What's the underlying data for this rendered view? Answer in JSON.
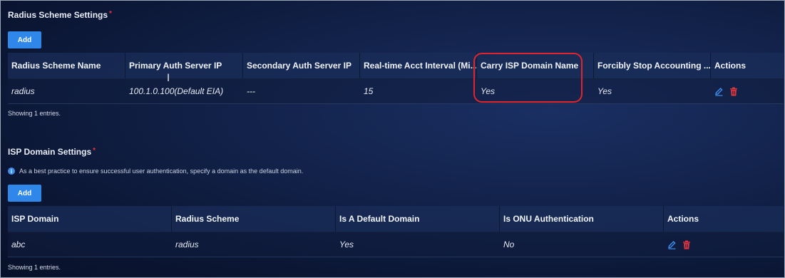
{
  "radius": {
    "title": "Radius Scheme Settings",
    "required_mark": "*",
    "add_label": "Add",
    "columns": [
      "Radius Scheme Name",
      "Primary Auth Server IP",
      "Secondary Auth Server IP",
      "Real-time Acct Interval (Mi...",
      "Carry ISP Domain Name",
      "Forcibly Stop Accounting ...",
      "Actions"
    ],
    "rows": [
      [
        "radius",
        "100.1.0.100(Default EIA)",
        "---",
        "15",
        "Yes",
        "Yes"
      ]
    ],
    "showing": "Showing 1 entries."
  },
  "isp": {
    "title": "ISP Domain Settings",
    "required_mark": "*",
    "info_text": "As a best practice to ensure successful user authentication, specify a domain as the default domain.",
    "add_label": "Add",
    "columns": [
      "ISP Domain",
      "Radius Scheme",
      "Is A Default Domain",
      "Is ONU Authentication",
      "Actions"
    ],
    "rows": [
      [
        "abc",
        "radius",
        "Yes",
        "No"
      ]
    ],
    "showing": "Showing 1 entries."
  },
  "icons": {
    "edit": "edit-icon",
    "delete": "trash-icon",
    "info": "info-icon"
  },
  "colors": {
    "accent": "#2f87ea",
    "required": "#e0353d",
    "highlight": "#e0252e",
    "edit_icon": "#3d8ef0",
    "delete_icon": "#e0353d"
  }
}
